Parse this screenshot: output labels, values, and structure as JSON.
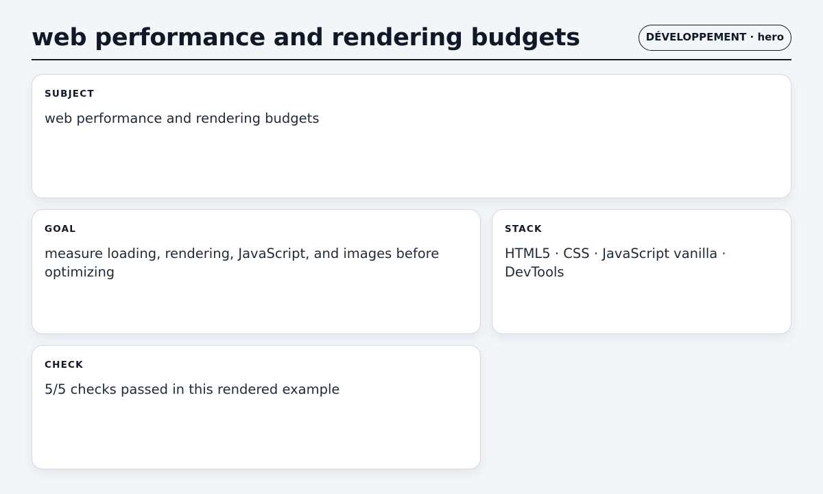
{
  "header": {
    "title": "web performance and rendering budgets",
    "badge": "DÉVELOPPEMENT · hero"
  },
  "cards": {
    "subject": {
      "label": "SUBJECT",
      "text": "web performance and rendering budgets"
    },
    "goal": {
      "label": "GOAL",
      "text": "measure loading, rendering, JavaScript, and images before optimizing"
    },
    "stack": {
      "label": "STACK",
      "text": "HTML5 · CSS · JavaScript vanilla · DevTools"
    },
    "check": {
      "label": "CHECK",
      "text": "5/5 checks passed in this rendered example"
    }
  },
  "colors": {
    "background": "#f3f6f9",
    "card": "#ffffff",
    "ink": "#111827",
    "border": "#d4dae1"
  }
}
